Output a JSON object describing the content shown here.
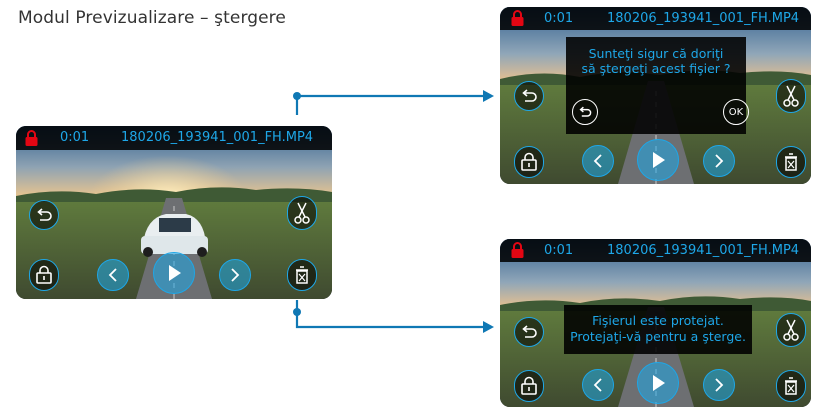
{
  "page": {
    "title": "Modul Previzualizare – ştergere"
  },
  "colors": {
    "accent": "#1ea7e8",
    "lock": "#e30613",
    "connector": "#0f78b4"
  },
  "main_screen": {
    "time": "0:01",
    "filename": "180206_193941_001_FH.MP4"
  },
  "confirm_screen": {
    "time": "0:01",
    "filename": "180206_193941_001_FH.MP4",
    "dialog_line1": "Sunteţi sigur că doriţi",
    "dialog_line2": "să ştergeţi acest fişier ?",
    "ok_label": "OK"
  },
  "protected_screen": {
    "time": "0:01",
    "filename": "180206_193941_001_FH.MP4",
    "dialog_line1": "Fişierul este protejat.",
    "dialog_line2": "Protejaţi-vă pentru a şterge."
  },
  "icons": [
    "lock-icon",
    "back-icon",
    "cut-icon",
    "protect-icon",
    "previous-icon",
    "play-icon",
    "next-icon",
    "delete-icon",
    "ok-icon"
  ]
}
